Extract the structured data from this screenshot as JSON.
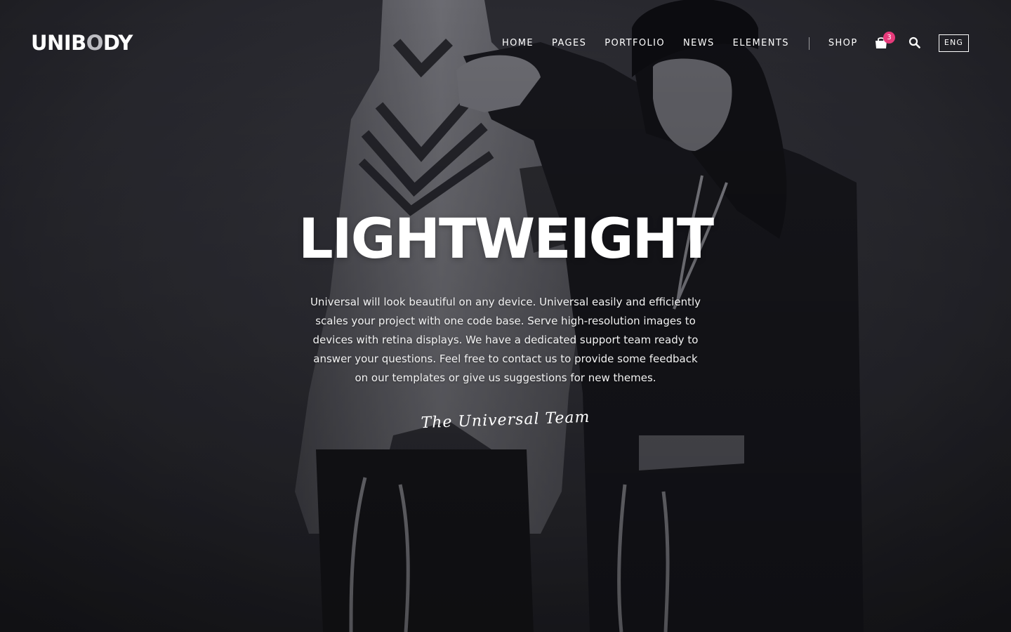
{
  "header": {
    "logo_main": "UNIB",
    "logo_accent": "O",
    "logo_tail": "DY",
    "nav": [
      "HOME",
      "PAGES",
      "PORTFOLIO",
      "NEWS",
      "ELEMENTS"
    ],
    "shop_label": "SHOP",
    "cart_count": "3",
    "language": "ENG"
  },
  "hero": {
    "headline": "LIGHTWEIGHT",
    "body": "Universal will look beautiful on any device. Universal easily and efficiently scales your project with one code base. Serve high-resolution images to devices with retina displays. We have a dedicated support team ready to answer your questions. Feel free to contact us to provide some feedback on our templates or give us suggestions for new themes.",
    "signature": "The Universal Team"
  },
  "icons": {
    "cart": "shopping-bag-icon",
    "search": "search-icon"
  },
  "colors": {
    "badge": "#e63a7a",
    "background": "#1e1e22"
  }
}
